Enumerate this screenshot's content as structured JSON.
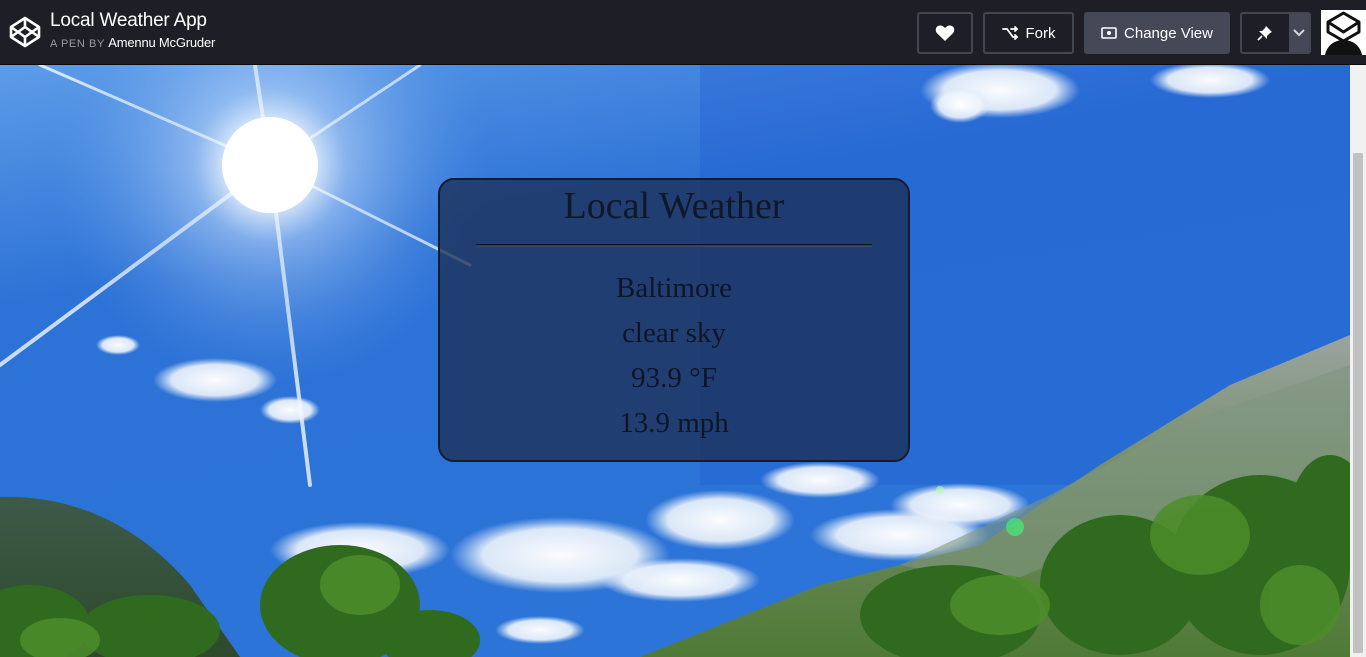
{
  "header": {
    "app_title": "Local Weather App",
    "byline_prefix": "A PEN BY",
    "author": "Amennu McGruder",
    "buttons": {
      "heart_icon": "heart-icon",
      "fork_label": "Fork",
      "change_view_label": "Change View",
      "pin_icon": "pin-icon",
      "dropdown_icon": "chevron-down-icon"
    }
  },
  "weather": {
    "heading": "Local Weather",
    "city": "Baltimore",
    "description": "clear sky",
    "temperature": "93.9 °F",
    "wind": "13.9 mph"
  },
  "colors": {
    "topbar": "#1e1f26",
    "accent_button": "#444857",
    "card": "#1c3055",
    "sky": "#2a6fd2"
  }
}
